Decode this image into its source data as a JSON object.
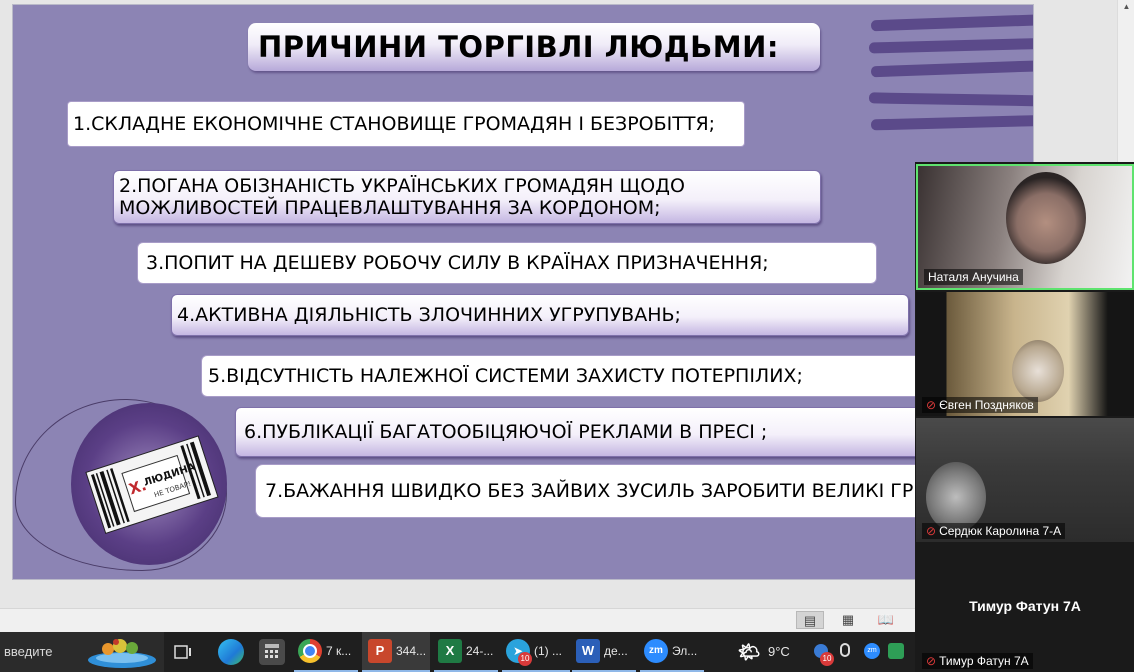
{
  "slide": {
    "title": "ПРИЧИНИ ТОРГІВЛІ ЛЮДЬМИ:",
    "items": [
      {
        "text": "1.СКЛАДНЕ ЕКОНОМІЧНЕ СТАНОВИЩЕ ГРОМАДЯН І БЕЗРОБІТТЯ;"
      },
      {
        "line1": "2.ПОГАНА ОБІЗНАНІСТЬ УКРАЇНСЬКИХ ГРОМАДЯН ЩОДО",
        "line2": "МОЖЛИВОСТЕЙ ПРАЦЕВЛАШТУВАННЯ ЗА КОРДОНОМ;"
      },
      {
        "text": "3.ПОПИТ НА ДЕШЕВУ РОБОЧУ СИЛУ В КРАЇНАХ ПРИЗНАЧЕННЯ;"
      },
      {
        "text": "4.АКТИВНА ДІЯЛЬНІСТЬ ЗЛОЧИННИХ УГРУПУВАНЬ;"
      },
      {
        "text": "5.ВІДСУТНІСТЬ НАЛЕЖНОЇ СИСТЕМИ ЗАХИСТУ ПОТЕРПІЛИХ;"
      },
      {
        "text": "6.ПУБЛІКАЦІЇ БАГАТООБІЦЯЮЧОЇ РЕКЛАМИ В ПРЕСІ ;"
      },
      {
        "text": "7.БАЖАННЯ ШВИДКО БЕЗ ЗАЙВИХ ЗУСИЛЬ ЗАРОБИТИ ВЕЛИКІ ГР"
      }
    ],
    "logo": {
      "word1": "ЛЮДИНА",
      "word2": "НЕ ТОВАР!",
      "letter": "Х."
    }
  },
  "participants": [
    {
      "name": "Наталя Анучина",
      "muted": false,
      "active_speaker": true
    },
    {
      "name": "Євген Поздняков",
      "muted": true
    },
    {
      "name": "Сердюк Каролина 7-А",
      "muted": true
    },
    {
      "name": "Тимур Фатун 7А",
      "muted": true,
      "video_off": true,
      "center_label": "Тимур Фатун 7А"
    }
  ],
  "taskbar": {
    "search_placeholder": "введите",
    "apps": [
      {
        "id": "chrome",
        "label": "7 к..."
      },
      {
        "id": "powerpoint",
        "label": "344..."
      },
      {
        "id": "excel",
        "label": "24-..."
      },
      {
        "id": "telegram",
        "label": "(1) ...",
        "badge": "10"
      },
      {
        "id": "word",
        "label": "де..."
      },
      {
        "id": "zoom",
        "label": "Эл..."
      }
    ],
    "weather": "9°C",
    "tray_badge": "10"
  },
  "colors": {
    "slide_bg": "#8c84b4",
    "stripe": "#5b4a8a",
    "active_speaker": "#5fe36f",
    "muted_icon": "#e03b3b"
  }
}
